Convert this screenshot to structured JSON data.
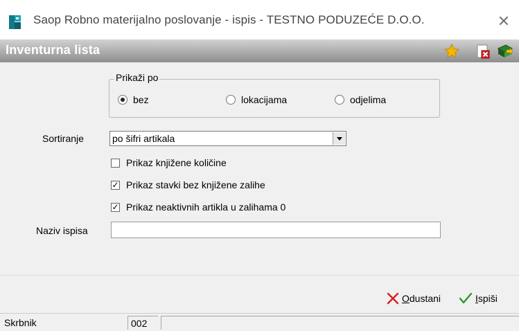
{
  "window": {
    "title": "Saop Robno materijalno poslovanje - ispis - TESTNO PODUZEĆE D.O.O.",
    "close_glyph": "✕"
  },
  "header": {
    "title": "Inventurna lista",
    "icons": [
      "star-icon",
      "delete-document-icon",
      "book-exit-icon"
    ]
  },
  "group": {
    "title": "Prikaži po",
    "options": [
      {
        "label": "bez",
        "selected": true
      },
      {
        "label": "lokacijama",
        "selected": false
      },
      {
        "label": "odjelima",
        "selected": false
      }
    ]
  },
  "sort": {
    "label": "Sortiranje",
    "value": "po šifri artikala"
  },
  "checkboxes": [
    {
      "label": "Prikaz knjižene količine",
      "checked": false
    },
    {
      "label": "Prikaz stavki bez knjižene zalihe",
      "checked": true
    },
    {
      "label": "Prikaz neaktivnih artikla u zalihama 0",
      "checked": true
    }
  ],
  "report_name": {
    "label": "Naziv ispisa",
    "value": ""
  },
  "buttons": {
    "cancel": {
      "hotkey": "O",
      "rest": "dustani",
      "color": "#d42020"
    },
    "print": {
      "hotkey": "I",
      "rest": "spiši",
      "color": "#2a9a2a"
    }
  },
  "status": {
    "user": "Skrbnik",
    "code": "002",
    "extra": ""
  }
}
